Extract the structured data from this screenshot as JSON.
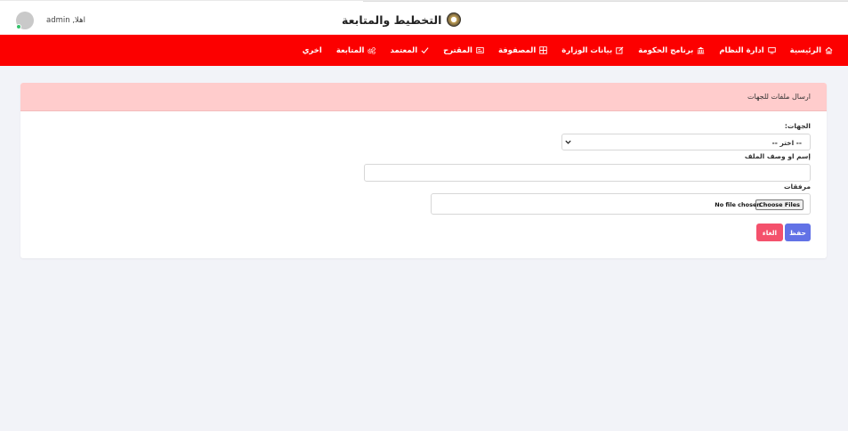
{
  "header": {
    "title": "التخطيط والمتابعة",
    "greeting": "اهلا, admin"
  },
  "nav": {
    "items": [
      {
        "label": "الرئيسية",
        "icon": "home-icon"
      },
      {
        "label": "ادارة النظام",
        "icon": "monitor-icon"
      },
      {
        "label": "برنامج الحكومة",
        "icon": "bank-icon"
      },
      {
        "label": "بيانات الوزارة",
        "icon": "edit-icon"
      },
      {
        "label": "المصفوفة",
        "icon": "grid-icon"
      },
      {
        "label": "المقترح",
        "icon": "id-card-icon"
      },
      {
        "label": "المعتمد",
        "icon": "check-icon"
      },
      {
        "label": "المتابعة",
        "icon": "cogs-icon"
      },
      {
        "label": "اخري",
        "icon": ""
      }
    ]
  },
  "form": {
    "header": "ارسال ملفات للجهات",
    "entities_label": "الجهات:",
    "entities_selected": "-- اختر --",
    "name_label": "إسم او وصف الملف",
    "name_value": "",
    "attachments_label": "مرفقات",
    "choose_files": "Choose Files",
    "no_file": "No file chosen",
    "save_label": "حفظ",
    "cancel_label": "الغاء"
  },
  "colors": {
    "navbar": "#fc0000",
    "card_header": "#ffcccc",
    "save_button": "#6272e6",
    "cancel_button": "#f4516c"
  }
}
